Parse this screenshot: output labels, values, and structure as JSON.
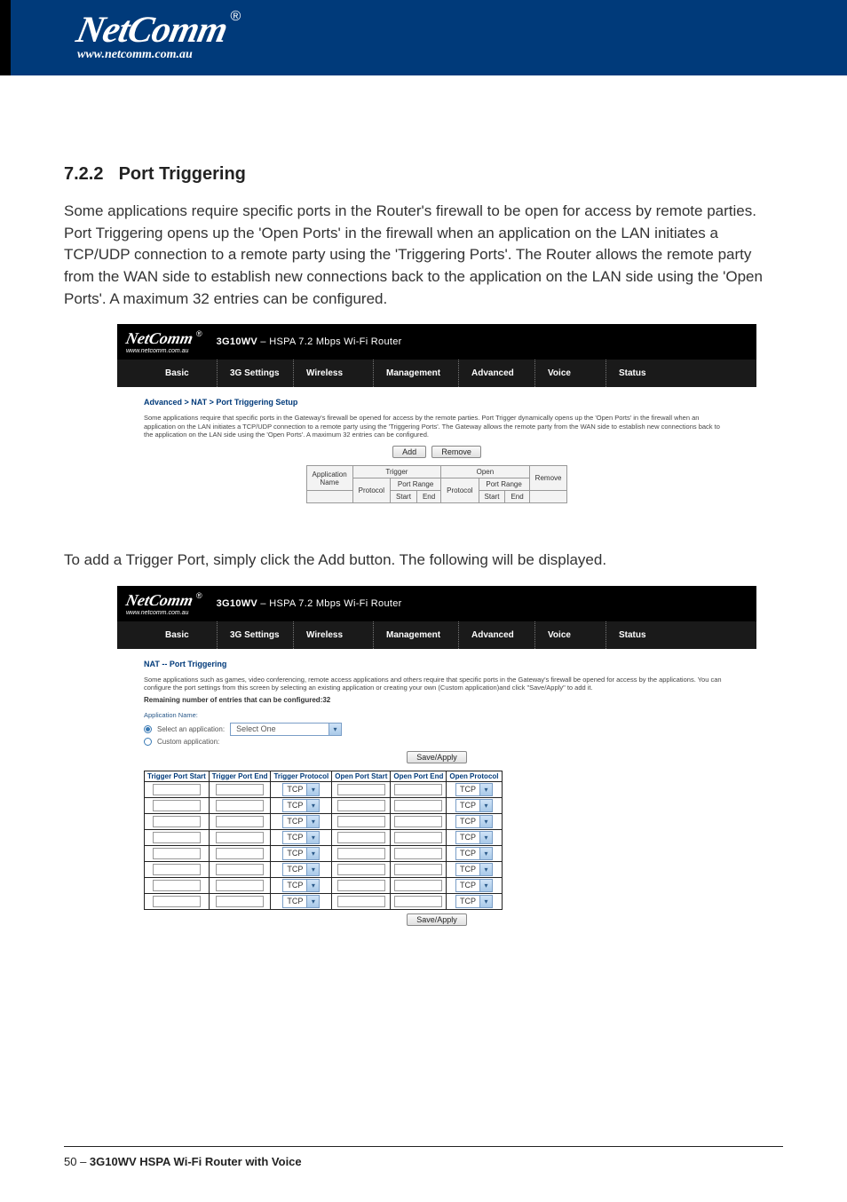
{
  "brand": {
    "name": "NetComm",
    "reg": "®",
    "url": "www.netcomm.com.au"
  },
  "section": {
    "number": "7.2.2",
    "title": "Port Triggering"
  },
  "para1": "Some applications require specific ports in the Router's firewall to be open for access by remote parties. Port Triggering opens up the 'Open Ports' in the firewall when an application on the LAN initiates a TCP/UDP connection to a remote party using the 'Triggering Ports'. The Router allows the remote party from the WAN side to establish new connections back to the application on the LAN side using the 'Open Ports'. A maximum 32 entries can be configured.",
  "para2": "To add a Trigger Port, simply click the Add button. The following will be displayed.",
  "router_title": {
    "model": "3G10WV",
    "desc": " – HSPA 7.2 Mbps Wi-Fi Router"
  },
  "tabs": [
    "Basic",
    "3G Settings",
    "Wireless",
    "Management",
    "Advanced",
    "Voice",
    "Status"
  ],
  "shot1": {
    "crumb": "Advanced > NAT > Port Triggering Setup",
    "desc": "Some applications require that specific ports in the Gateway's firewall be opened for access by the remote parties. Port Trigger dynamically opens up the 'Open Ports' in the firewall when an application on the LAN initiates a TCP/UDP connection to a remote party using the 'Triggering Ports'. The Gateway allows the remote party from the WAN side to establish new connections back to the application on the LAN side using the 'Open Ports'. A maximum 32 entries can be configured.",
    "btn_add": "Add",
    "btn_remove": "Remove",
    "th": {
      "app": "Application",
      "name": "Name",
      "trigger": "Trigger",
      "open": "Open",
      "remove": "Remove",
      "protocol": "Protocol",
      "portrange": "Port Range",
      "start": "Start",
      "end": "End"
    }
  },
  "shot2": {
    "crumb": "NAT -- Port Triggering",
    "desc": "Some applications such as games, video conferencing, remote access applications and others require that specific ports in the Gateway's firewall be opened for access by the applications. You can configure the port settings from this screen by selecting an existing application or creating your own (Custom application)and click \"Save/Apply\" to add it.",
    "remaining": "Remaining number of entries that can be configured:32",
    "appname_label": "Application Name:",
    "radio_select": "Select an application:",
    "radio_custom": "Custom application:",
    "select_value": "Select One",
    "btn_save": "Save/Apply",
    "th": {
      "tps": "Trigger Port Start",
      "tpe": "Trigger Port End",
      "tproto": "Trigger Protocol",
      "ops": "Open Port Start",
      "ope": "Open Port End",
      "oproto": "Open Protocol"
    },
    "proto": "TCP",
    "rows": 8
  },
  "footer": {
    "page": "50 – ",
    "model": "3G10WV HSPA Wi-Fi Router with Voice"
  }
}
